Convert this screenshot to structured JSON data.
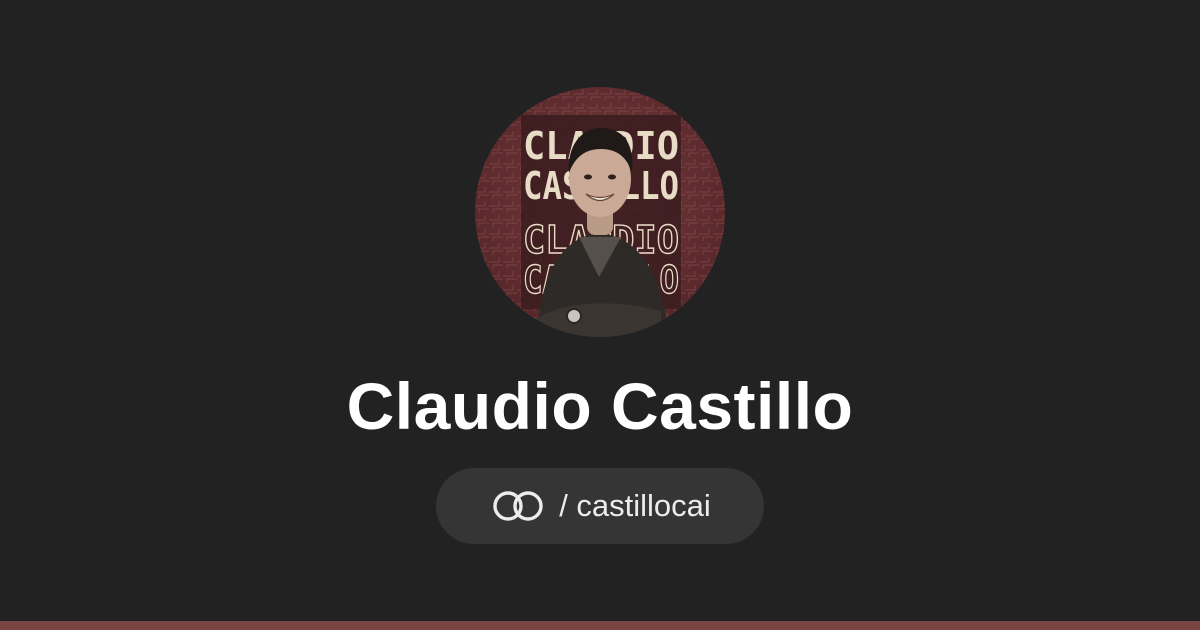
{
  "profile": {
    "name": "Claudio Castillo",
    "avatar_lettering": [
      "CLAUDIO",
      "CASTILLO",
      "CLAUDIO",
      "CASTILLO"
    ]
  },
  "handle": {
    "icon": "linked-rings-icon",
    "text": "/ castillocai"
  },
  "colors": {
    "background": "#222222",
    "pill": "#353535",
    "accent_bar": "#7a4442",
    "avatar_bg": "#6b3336"
  }
}
